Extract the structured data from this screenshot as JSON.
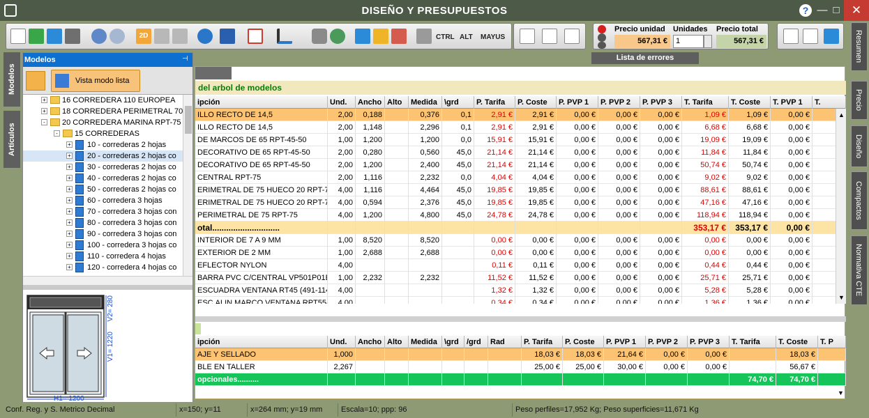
{
  "window": {
    "title": "DISEÑO Y PRESUPUESTOS",
    "help_label": "?",
    "min_label": "—",
    "max_label": "□",
    "close_label": "✕"
  },
  "toolbar": {
    "ctrl_label": "CTRL",
    "alt_label": "ALT",
    "mayus_label": "MAYUS",
    "precio_unidad_label": "Precio unidad",
    "precio_unidad_value": "567,31 €",
    "unidades_label": "Unidades",
    "unidades_value": "1",
    "precio_total_label": "Precio total",
    "precio_total_value": "567,31 €"
  },
  "errors_panel": {
    "title": "Lista de errores"
  },
  "left_tabs": {
    "modelos": "Modelos",
    "articulos": "Artículos"
  },
  "right_tabs": {
    "resumen": "Resumen",
    "precio": "Precio",
    "diseno": "Diseño",
    "compactos": "Compactos",
    "normativa": "Normativa CTE"
  },
  "models_panel": {
    "title": "Modelos",
    "view_button": "Vista modo lista",
    "tree": [
      {
        "label": "16 CORREDERA 110 EUROPEA",
        "level": 0,
        "icon": "folder",
        "pm": "+"
      },
      {
        "label": "18 CORREDERA PERIMETRAL 70",
        "level": 0,
        "icon": "folder",
        "pm": "+"
      },
      {
        "label": "20 CORREDERA MARINA RPT-75",
        "level": 0,
        "icon": "folder",
        "pm": "-"
      },
      {
        "label": "15 CORREDERAS",
        "level": 1,
        "icon": "folder",
        "pm": "-"
      },
      {
        "label": "10 - correderas 2 hojas",
        "level": 2,
        "icon": "window",
        "pm": "+"
      },
      {
        "label": "20 - correderas 2 hojas co",
        "level": 2,
        "icon": "window",
        "pm": "+",
        "selected": true
      },
      {
        "label": "30 - correderas 2 hojas co",
        "level": 2,
        "icon": "window",
        "pm": "+"
      },
      {
        "label": "40 - correderas 2 hojas co",
        "level": 2,
        "icon": "window",
        "pm": "+"
      },
      {
        "label": "50 - correderas 2 hojas co",
        "level": 2,
        "icon": "window",
        "pm": "+"
      },
      {
        "label": "60 - corredera 3 hojas",
        "level": 2,
        "icon": "window",
        "pm": "+"
      },
      {
        "label": "70 - corredera 3 hojas con",
        "level": 2,
        "icon": "window",
        "pm": "+"
      },
      {
        "label": "80 - corredera 3 hojas con",
        "level": 2,
        "icon": "window",
        "pm": "+"
      },
      {
        "label": "90 - corredera 3 hojas con",
        "level": 2,
        "icon": "window",
        "pm": "+"
      },
      {
        "label": "100 - corredera 3 hojas co",
        "level": 2,
        "icon": "window",
        "pm": "+"
      },
      {
        "label": "110 - corredera 4 hojas",
        "level": 2,
        "icon": "window",
        "pm": "+"
      },
      {
        "label": "120 - corredera 4 hojas co",
        "level": 2,
        "icon": "window",
        "pm": "+"
      }
    ],
    "preview": {
      "v2": "V2= 280",
      "v1": "V1= 1220",
      "h1": "H1= 1200"
    }
  },
  "main": {
    "group_title": "del arbol de modelos",
    "top_headers": [
      "ipción",
      "Und.",
      "Ancho",
      "Alto",
      "Medida",
      "\\grd",
      "P. Tarifa",
      "P. Coste",
      "P. PVP 1",
      "P. PVP 2",
      "P. PVP 3",
      "T. Tarifa",
      "T. Coste",
      "T. PVP 1",
      "T."
    ],
    "top_rows": [
      {
        "cells": [
          "ILLO RECTO DE 14,5",
          "2,00",
          "0,188",
          "",
          "0,376",
          "0,1",
          "2,91 €",
          "2,91 €",
          "0,00 €",
          "0,00 €",
          "0,00 €",
          "1,09 €",
          "1,09 €",
          "0,00 €",
          ""
        ],
        "kind": "selected"
      },
      {
        "cells": [
          "ILLO RECTO DE 14,5",
          "2,00",
          "1,148",
          "",
          "2,296",
          "0,1",
          "2,91 €",
          "2,91 €",
          "0,00 €",
          "0,00 €",
          "0,00 €",
          "6,68 €",
          "6,68 €",
          "0,00 €",
          ""
        ]
      },
      {
        "cells": [
          "DE MARCOS DE 65 RPT-45-50",
          "1,00",
          "1,200",
          "",
          "1,200",
          "0,0",
          "15,91 €",
          "15,91 €",
          "0,00 €",
          "0,00 €",
          "0,00 €",
          "19,09 €",
          "19,09 €",
          "0,00 €",
          ""
        ]
      },
      {
        "cells": [
          "DECORATIVO DE 65 RPT-45-50",
          "2,00",
          "0,280",
          "",
          "0,560",
          "45,0",
          "21,14 €",
          "21,14 €",
          "0,00 €",
          "0,00 €",
          "0,00 €",
          "11,84 €",
          "11,84 €",
          "0,00 €",
          ""
        ]
      },
      {
        "cells": [
          "DECORATIVO DE 65 RPT-45-50",
          "2,00",
          "1,200",
          "",
          "2,400",
          "45,0",
          "21,14 €",
          "21,14 €",
          "0,00 €",
          "0,00 €",
          "0,00 €",
          "50,74 €",
          "50,74 €",
          "0,00 €",
          ""
        ]
      },
      {
        "cells": [
          "CENTRAL RPT-75",
          "2,00",
          "1,116",
          "",
          "2,232",
          "0,0",
          "4,04 €",
          "4,04 €",
          "0,00 €",
          "0,00 €",
          "0,00 €",
          "9,02 €",
          "9,02 €",
          "0,00 €",
          ""
        ]
      },
      {
        "cells": [
          "ERIMETRAL DE 75 HUECO 20 RPT-75",
          "4,00",
          "1,116",
          "",
          "4,464",
          "45,0",
          "19,85 €",
          "19,85 €",
          "0,00 €",
          "0,00 €",
          "0,00 €",
          "88,61 €",
          "88,61 €",
          "0,00 €",
          ""
        ]
      },
      {
        "cells": [
          "ERIMETRAL DE 75 HUECO 20 RPT-75",
          "4,00",
          "0,594",
          "",
          "2,376",
          "45,0",
          "19,85 €",
          "19,85 €",
          "0,00 €",
          "0,00 €",
          "0,00 €",
          "47,16 €",
          "47,16 €",
          "0,00 €",
          ""
        ]
      },
      {
        "cells": [
          "PERIMETRAL DE 75 RPT-75",
          "4,00",
          "1,200",
          "",
          "4,800",
          "45,0",
          "24,78 €",
          "24,78 €",
          "0,00 €",
          "0,00 €",
          "0,00 €",
          "118,94 €",
          "118,94 €",
          "0,00 €",
          ""
        ]
      },
      {
        "cells": [
          "otal.............................",
          "",
          "",
          "",
          "",
          "",
          "",
          "",
          "",
          "",
          "",
          "353,17 €",
          "353,17 €",
          "0,00 €",
          ""
        ],
        "kind": "total"
      },
      {
        "cells": [
          "INTERIOR DE 7 A 9 MM",
          "1,00",
          "8,520",
          "",
          "8,520",
          "",
          "0,00 €",
          "0,00 €",
          "0,00 €",
          "0,00 €",
          "0,00 €",
          "0,00 €",
          "0,00 €",
          "0,00 €",
          ""
        ]
      },
      {
        "cells": [
          "EXTERIOR DE 2 MM",
          "1,00",
          "2,688",
          "",
          "2,688",
          "",
          "0,00 €",
          "0,00 €",
          "0,00 €",
          "0,00 €",
          "0,00 €",
          "0,00 €",
          "0,00 €",
          "0,00 €",
          ""
        ]
      },
      {
        "cells": [
          "EFLECTOR NYLON",
          "4,00",
          "",
          "",
          "",
          "",
          "0,11 €",
          "0,11 €",
          "0,00 €",
          "0,00 €",
          "0,00 €",
          "0,44 €",
          "0,44 €",
          "0,00 €",
          ""
        ]
      },
      {
        "cells": [
          "BARRA PVC C/CENTRAL VP501P01E01",
          "1,00",
          "2,232",
          "",
          "2,232",
          "",
          "11,52 €",
          "11,52 €",
          "0,00 €",
          "0,00 €",
          "0,00 €",
          "25,71 €",
          "25,71 €",
          "0,00 €",
          ""
        ]
      },
      {
        "cells": [
          "ESCUADRA VENTANA RT45 (491-1143)",
          "4,00",
          "",
          "",
          "",
          "",
          "1,32 €",
          "1,32 €",
          "0,00 €",
          "0,00 €",
          "0,00 €",
          "5,28 €",
          "5,28 €",
          "0,00 €",
          ""
        ]
      },
      {
        "cells": [
          "ESC.ALIN.MARCO VENTANA RPT55-60.",
          "4,00",
          "",
          "",
          "",
          "",
          "0,34 €",
          "0,34 €",
          "0,00 €",
          "0,00 €",
          "0,00 €",
          "1,36 €",
          "1,36 €",
          "0,00 €",
          ""
        ]
      }
    ],
    "bottom_headers": [
      "ipción",
      "Und.",
      "Ancho",
      "Alto",
      "Medida",
      "\\grd",
      "/grd",
      "Rad",
      "P. Tarifa",
      "P. Coste",
      "P. PVP 1",
      "P. PVP 2",
      "P. PVP 3",
      "T. Tarifa",
      "T. Coste",
      "T. P"
    ],
    "bottom_rows": [
      {
        "cells": [
          "AJE Y SELLADO",
          "1,000",
          "",
          "",
          "",
          "",
          "",
          "",
          "18,03 €",
          "18,03 €",
          "21,64 €",
          "0,00 €",
          "0,00 €",
          "",
          "18,03 €",
          ""
        ],
        "kind": "selected"
      },
      {
        "cells": [
          "BLE EN TALLER",
          "2,267",
          "",
          "",
          "",
          "",
          "",
          "",
          "25,00 €",
          "25,00 €",
          "30,00 €",
          "0,00 €",
          "0,00 €",
          "",
          "56,67 €",
          ""
        ]
      },
      {
        "cells": [
          "opcionales..........",
          "",
          "",
          "",
          "",
          "",
          "",
          "",
          "",
          "",
          "",
          "",
          "",
          "74,70 €",
          "74,70 €",
          ""
        ],
        "kind": "green"
      }
    ]
  },
  "statusbar": {
    "s1": "Conf. Reg. y S. Metrico Decimal",
    "s2": "x=150; y=11",
    "s3": "x=264 mm; y=19 mm",
    "s4": "Escala=10; ppp: 96",
    "s5": "Peso perfiles=17,952 Kg; Peso superficies=11,671 Kg"
  },
  "colors": {
    "selected_row": "#fbc372",
    "total_row": "#fde4a4",
    "green_row": "#16c55a",
    "red_text": "#e00000"
  }
}
